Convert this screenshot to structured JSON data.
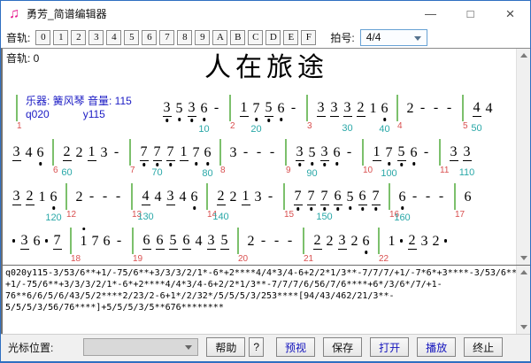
{
  "window": {
    "title": "勇芳_简谱编辑器",
    "controls": {
      "minimize": "—",
      "maximize": "□",
      "close": "×"
    }
  },
  "toolbar": {
    "track_label": "音轨:",
    "track_buttons": [
      "0",
      "1",
      "2",
      "3",
      "4",
      "5",
      "6",
      "7",
      "8",
      "9",
      "A",
      "B",
      "C",
      "D",
      "E",
      "F"
    ],
    "time_sig_label": "拍号:",
    "time_sig_value": "4/4"
  },
  "score": {
    "track_info": "音轨: 0",
    "title": "人在旅途",
    "instrument_text": "乐器: 簧风琴 音量: 115",
    "instrument_code": "q020",
    "volume_code": "y115",
    "lines": [
      [
        {
          "k": "bar",
          "m": "1"
        },
        {
          "k": "inst"
        },
        {
          "k": "n",
          "t": "3",
          "u": 1,
          "o": -1
        },
        {
          "k": "n",
          "t": "5",
          "o": -1
        },
        {
          "k": "n",
          "t": "3",
          "u": 1,
          "o": -1
        },
        {
          "k": "n",
          "t": "6",
          "o": -1,
          "p": "10"
        },
        {
          "k": "d"
        },
        {
          "k": "bar",
          "m": "2"
        },
        {
          "k": "n",
          "t": "1",
          "u": 1
        },
        {
          "k": "n",
          "t": "7",
          "o": -1,
          "p": "20"
        },
        {
          "k": "n",
          "t": "5",
          "u": 1,
          "o": -1
        },
        {
          "k": "n",
          "t": "6",
          "o": -1
        },
        {
          "k": "d"
        },
        {
          "k": "bar",
          "m": "3"
        },
        {
          "k": "n",
          "t": "3",
          "u": 1
        },
        {
          "k": "n",
          "t": "3",
          "u": 1
        },
        {
          "k": "n",
          "t": "3",
          "u": 1,
          "p": "30"
        },
        {
          "k": "n",
          "t": "2",
          "u": 1
        },
        {
          "k": "n",
          "t": "1"
        },
        {
          "k": "n",
          "t": "6",
          "o": -1,
          "p": "40"
        },
        {
          "k": "bar",
          "m": "4"
        },
        {
          "k": "n",
          "t": "2"
        },
        {
          "k": "d"
        },
        {
          "k": "d"
        },
        {
          "k": "d"
        },
        {
          "k": "bar",
          "m": "5"
        },
        {
          "k": "n",
          "t": "4",
          "u": 1,
          "p": "50"
        },
        {
          "k": "n",
          "t": "4"
        }
      ],
      [
        {
          "k": "n",
          "t": "3",
          "u": 1
        },
        {
          "k": "n",
          "t": "4"
        },
        {
          "k": "n",
          "t": "6",
          "o": -1
        },
        {
          "k": "bar",
          "m": "6"
        },
        {
          "k": "n",
          "t": "2",
          "u": 1,
          "p": "60"
        },
        {
          "k": "n",
          "t": "2"
        },
        {
          "k": "n",
          "t": "1",
          "u": 1
        },
        {
          "k": "n",
          "t": "3"
        },
        {
          "k": "d"
        },
        {
          "k": "bar",
          "m": "7"
        },
        {
          "k": "n",
          "t": "7",
          "u": 1,
          "o": -1
        },
        {
          "k": "n",
          "t": "7",
          "u": 1,
          "o": -1,
          "p": "70"
        },
        {
          "k": "n",
          "t": "7",
          "u": 1,
          "o": -1
        },
        {
          "k": "n",
          "t": "1",
          "u": 1
        },
        {
          "k": "n",
          "t": "7",
          "o": -1
        },
        {
          "k": "n",
          "t": "6",
          "o": -1,
          "p": "80"
        },
        {
          "k": "bar",
          "m": "8"
        },
        {
          "k": "n",
          "t": "3"
        },
        {
          "k": "d"
        },
        {
          "k": "d"
        },
        {
          "k": "d"
        },
        {
          "k": "bar",
          "m": "9"
        },
        {
          "k": "n",
          "t": "3",
          "u": 1,
          "o": -1
        },
        {
          "k": "n",
          "t": "5",
          "o": -1,
          "p": "90"
        },
        {
          "k": "n",
          "t": "3",
          "u": 1,
          "o": -1
        },
        {
          "k": "n",
          "t": "6",
          "o": -1
        },
        {
          "k": "d"
        },
        {
          "k": "bar",
          "m": "10"
        },
        {
          "k": "n",
          "t": "1",
          "u": 1
        },
        {
          "k": "n",
          "t": "7",
          "o": -1,
          "p": "100"
        },
        {
          "k": "n",
          "t": "5",
          "u": 1,
          "o": -1
        },
        {
          "k": "n",
          "t": "6",
          "o": -1
        },
        {
          "k": "d"
        },
        {
          "k": "bar",
          "m": "11"
        },
        {
          "k": "n",
          "t": "3",
          "u": 1
        },
        {
          "k": "n",
          "t": "3",
          "u": 1,
          "p": "110"
        }
      ],
      [
        {
          "k": "n",
          "t": "3",
          "u": 1
        },
        {
          "k": "n",
          "t": "2",
          "u": 1
        },
        {
          "k": "n",
          "t": "1"
        },
        {
          "k": "n",
          "t": "6",
          "o": -1,
          "p": "120"
        },
        {
          "k": "bar",
          "m": "12"
        },
        {
          "k": "n",
          "t": "2"
        },
        {
          "k": "d"
        },
        {
          "k": "d"
        },
        {
          "k": "d"
        },
        {
          "k": "bar",
          "m": "13"
        },
        {
          "k": "n",
          "t": "4",
          "u": 1,
          "p": "130"
        },
        {
          "k": "n",
          "t": "4"
        },
        {
          "k": "n",
          "t": "3",
          "u": 1
        },
        {
          "k": "n",
          "t": "4"
        },
        {
          "k": "n",
          "t": "6",
          "o": -1
        },
        {
          "k": "bar",
          "m": "14"
        },
        {
          "k": "n",
          "t": "2",
          "u": 1,
          "p": "140"
        },
        {
          "k": "n",
          "t": "2"
        },
        {
          "k": "n",
          "t": "1",
          "u": 1
        },
        {
          "k": "n",
          "t": "3"
        },
        {
          "k": "d"
        },
        {
          "k": "bar",
          "m": "15"
        },
        {
          "k": "n",
          "t": "7",
          "u": 1,
          "o": -1
        },
        {
          "k": "n",
          "t": "7",
          "u": 1,
          "o": -1
        },
        {
          "k": "n",
          "t": "7",
          "u": 1,
          "o": -1,
          "p": "150"
        },
        {
          "k": "n",
          "t": "6",
          "u": 1,
          "o": -1
        },
        {
          "k": "n",
          "t": "5",
          "o": -1
        },
        {
          "k": "n",
          "t": "6",
          "u": 1,
          "o": -1
        },
        {
          "k": "n",
          "t": "7",
          "u": 1,
          "o": -1
        },
        {
          "k": "bar",
          "m": "16"
        },
        {
          "k": "n",
          "t": "6",
          "o": -1,
          "p": "160"
        },
        {
          "k": "d"
        },
        {
          "k": "d"
        },
        {
          "k": "d"
        },
        {
          "k": "bar",
          "m": "17"
        },
        {
          "k": "n",
          "t": "6"
        }
      ],
      [
        {
          "k": "r"
        },
        {
          "k": "n",
          "t": "3",
          "u": 1
        },
        {
          "k": "n",
          "t": "6"
        },
        {
          "k": "r"
        },
        {
          "k": "n",
          "t": "7",
          "u": 1
        },
        {
          "k": "bar",
          "m": "18"
        },
        {
          "k": "n",
          "t": "1",
          "o": 1
        },
        {
          "k": "n",
          "t": "7"
        },
        {
          "k": "n",
          "t": "6"
        },
        {
          "k": "d"
        },
        {
          "k": "bar",
          "m": "19"
        },
        {
          "k": "n",
          "t": "6",
          "u": 1
        },
        {
          "k": "n",
          "t": "6",
          "u": 1
        },
        {
          "k": "n",
          "t": "5",
          "u": 1
        },
        {
          "k": "n",
          "t": "6",
          "u": 1
        },
        {
          "k": "n",
          "t": "4"
        },
        {
          "k": "n",
          "t": "3",
          "u": 1
        },
        {
          "k": "n",
          "t": "5",
          "u": 1
        },
        {
          "k": "bar",
          "m": "20"
        },
        {
          "k": "n",
          "t": "2"
        },
        {
          "k": "d"
        },
        {
          "k": "d"
        },
        {
          "k": "d"
        },
        {
          "k": "bar",
          "m": "21"
        },
        {
          "k": "n",
          "t": "2",
          "u": 1
        },
        {
          "k": "n",
          "t": "2"
        },
        {
          "k": "n",
          "t": "3",
          "u": 1
        },
        {
          "k": "n",
          "t": "2"
        },
        {
          "k": "n",
          "t": "6",
          "o": -1
        },
        {
          "k": "bar",
          "m": "22"
        },
        {
          "k": "n",
          "t": "1"
        },
        {
          "k": "r"
        },
        {
          "k": "n",
          "t": "2",
          "u": 1
        },
        {
          "k": "n",
          "t": "3"
        },
        {
          "k": "n",
          "t": "2"
        },
        {
          "k": "r"
        }
      ]
    ]
  },
  "code_editor": {
    "lines": [
      "q020y115-3/53/6**+1/-75/6**+3/3/3/2/1*-6*+2****4/4*3/4-6+2/2*1/3**-7/7/7/+1/-7*6*+3****-3/53/6**",
      "+1/-75/6**+3/3/3/2/1*-6*+2****4/4*3/4-6+2/2*1/3**-7/7/7/6/56/7/6****+6*/3/6*/7/+1-",
      "76**6/6/5/6/43/5/2****2/23/2-6+1*/2/32*/5/5/5/3/253****[94/43/462/21/3**-",
      "5/5/5/3/56/76****]+5/5/5/3/5**676********"
    ]
  },
  "statusbar": {
    "cursor_label": "光标位置:",
    "combo_value": "",
    "buttons": [
      {
        "name": "help-button",
        "label": "帮助"
      },
      {
        "name": "help-question-button",
        "label": "?",
        "narrow": true
      },
      {
        "name": "preview-button",
        "label": "预视",
        "accent": true,
        "gap": true
      },
      {
        "name": "save-button",
        "label": "保存"
      },
      {
        "name": "open-button",
        "label": "打开",
        "accent": true
      },
      {
        "name": "play-button",
        "label": "播放",
        "accent": true
      },
      {
        "name": "stop-button",
        "label": "终止"
      }
    ]
  },
  "colors": {
    "window_border": "#2f6fc1",
    "icon_pink": "#e5138a",
    "instrument_blue": "#1b1bc4",
    "measure_red": "#d94f4f",
    "position_teal": "#2aa8a8",
    "barline_green": "#7cc06c",
    "button_blue": "#1414bd"
  }
}
